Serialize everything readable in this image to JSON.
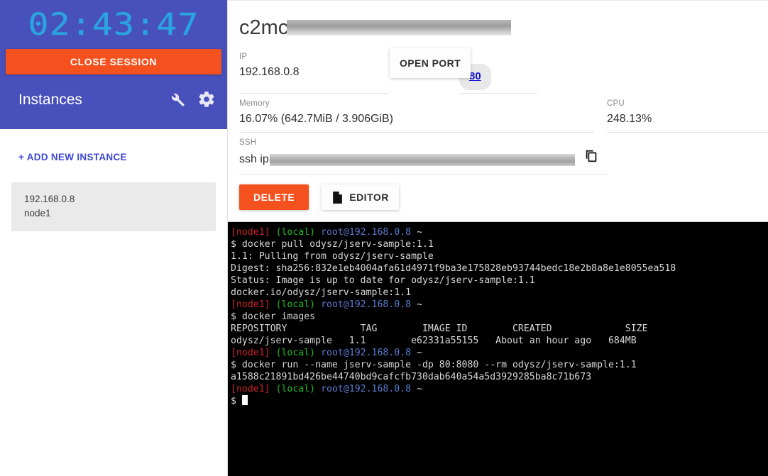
{
  "sidebar": {
    "timer": "02:43:47",
    "close_session_label": "CLOSE SESSION",
    "instances_title": "Instances",
    "wrench_icon": "wrench-icon",
    "gear_icon": "gear-icon",
    "add_instance_label": "+ ADD NEW INSTANCE",
    "instances": [
      {
        "ip": "192.168.0.8",
        "name": "node1"
      }
    ]
  },
  "main": {
    "session_title": "c2mc",
    "fields": {
      "ip_label": "IP",
      "ip_value": "192.168.0.8",
      "memory_label": "Memory",
      "memory_value": "16.07% (642.7MiB / 3.906GiB)",
      "cpu_label": "CPU",
      "cpu_value": "248.13%",
      "ssh_label": "SSH",
      "ssh_value": "ssh ip",
      "copy_icon": "copy-icon"
    },
    "open_port_label": "OPEN PORT",
    "port_chip": "80",
    "delete_label": "DELETE",
    "editor_label": "EDITOR",
    "editor_icon": "file-icon"
  },
  "terminal": {
    "prompt": {
      "host": "[node1]",
      "env": "(local)",
      "user": "root@192.168.0.8",
      "cwd": "~"
    },
    "lines": [
      {
        "type": "prompt"
      },
      {
        "type": "text",
        "text": "$ docker pull odysz/jserv-sample:1.1"
      },
      {
        "type": "text",
        "text": "1.1: Pulling from odysz/jserv-sample"
      },
      {
        "type": "text",
        "text": "Digest: sha256:832e1eb4004afa61d4971f9ba3e175828eb93744bedc18e2b8a8e1e8055ea518"
      },
      {
        "type": "text",
        "text": "Status: Image is up to date for odysz/jserv-sample:1.1"
      },
      {
        "type": "text",
        "text": "docker.io/odysz/jserv-sample:1.1"
      },
      {
        "type": "prompt"
      },
      {
        "type": "text",
        "text": "$ docker images"
      },
      {
        "type": "text",
        "text": "REPOSITORY             TAG        IMAGE ID        CREATED             SIZE"
      },
      {
        "type": "text",
        "text": "odysz/jserv-sample   1.1        e62331a55155   About an hour ago   684MB"
      },
      {
        "type": "prompt"
      },
      {
        "type": "text",
        "text": "$ docker run --name jserv-sample -dp 80:8080 --rm odysz/jserv-sample:1.1"
      },
      {
        "type": "text",
        "text": "a1588c21891bd426be44740bd9cafcfb730dab640a54a5d3929285ba8c71b673"
      },
      {
        "type": "prompt"
      },
      {
        "type": "cursor",
        "text": "$ "
      }
    ]
  },
  "colors": {
    "sidebar_bg": "#4750bb",
    "accent_orange": "#f4511e",
    "timer_cyan": "#2aa3e0",
    "link_blue": "#1414d8",
    "terminal_bg": "#000000"
  }
}
